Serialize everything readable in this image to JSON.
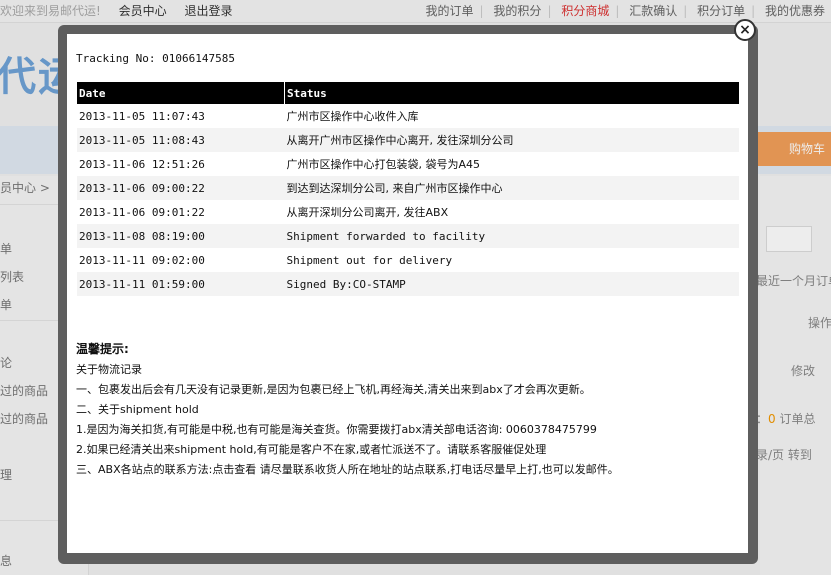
{
  "header": {
    "welcome": "欢迎来到易邮代运!",
    "member_center": "会员中心",
    "logout": "退出登录",
    "nav": [
      "我的订单",
      "我的积分",
      "积分商城",
      "汇款确认",
      "积分订单",
      "我的优惠券"
    ],
    "highlight_color": "#dd3333"
  },
  "logo_text": "代运",
  "cart_label": "购物车",
  "breadcrumb": "员中心 >",
  "sidebar": {
    "items": [
      "单",
      "列表",
      "单",
      "论",
      "过的商品",
      "过的商品",
      "理",
      "息"
    ]
  },
  "right_panel": {
    "recent": "最近一个月订单",
    "action": "操作",
    "edit": "修改",
    "count_prefix": "：",
    "count_value": "0",
    "total_label": "订单总",
    "per_page": "录/页",
    "goto": "转到"
  },
  "modal": {
    "close_symbol": "×",
    "tracking_label": "Tracking No:",
    "tracking_number": "01066147585",
    "table": {
      "headers": [
        "Date",
        "Status"
      ],
      "rows": [
        {
          "date": "2013-11-05 11:07:43",
          "status": "广州市区操作中心收件入库"
        },
        {
          "date": "2013-11-05 11:08:43",
          "status": "从离开广州市区操作中心离开, 发往深圳分公司"
        },
        {
          "date": "2013-11-06 12:51:26",
          "status": "广州市区操作中心打包装袋, 袋号为A45"
        },
        {
          "date": "2013-11-06 09:00:22",
          "status": "到达到达深圳分公司, 来自广州市区操作中心"
        },
        {
          "date": "2013-11-06 09:01:22",
          "status": "从离开深圳分公司离开, 发往ABX"
        },
        {
          "date": "2013-11-08 08:19:00",
          "status": "Shipment forwarded to facility"
        },
        {
          "date": "2013-11-11 09:02:00",
          "status": "Shipment out for delivery"
        },
        {
          "date": "2013-11-11 01:59:00",
          "status": "Signed By:CO-STAMP"
        }
      ]
    },
    "tips": {
      "title": "温馨提示:",
      "lines": [
        "关于物流记录",
        "一、包裹发出后会有几天没有记录更新,是因为包裹已经上飞机,再经海关,清关出来到abx了才会再次更新。",
        "二、关于shipment hold",
        "1.是因为海关扣货,有可能是中税,也有可能是海关查货。你需要拨打abx清关部电话咨询: 0060378475799",
        "2.如果已经清关出来shipment hold,有可能是客户不在家,或者忙派送不了。请联系客服催促处理"
      ],
      "last_line_prefix": "三、ABX各站点的联系方法:",
      "last_line_link": "点击查看",
      "last_line_suffix": " 请尽量联系收货人所在地址的站点联系,打电话尽量早上打,也可以发邮件。"
    }
  }
}
